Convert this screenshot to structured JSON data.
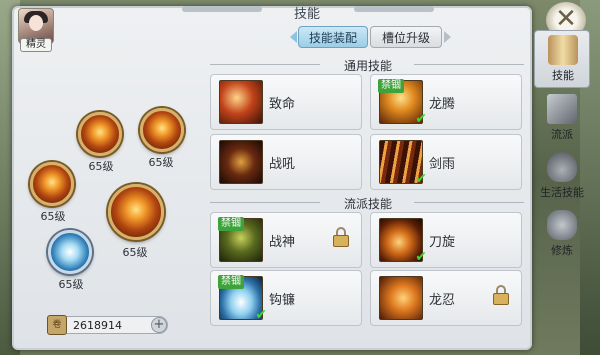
{
  "window": {
    "title": "技能",
    "close_label": "✕"
  },
  "avatar": {
    "label": "精灵"
  },
  "tabs": [
    {
      "label": "技能装配",
      "active": true
    },
    {
      "label": "槽位升级",
      "active": false
    }
  ],
  "sections": {
    "common": "通用技能",
    "school": "流派技能"
  },
  "common_skills": [
    {
      "name": "致命",
      "badge": "",
      "equipped": false,
      "locked": false
    },
    {
      "name": "龙腾",
      "badge": "禁锢",
      "equipped": true,
      "locked": false
    },
    {
      "name": "战吼",
      "badge": "",
      "equipped": false,
      "locked": false
    },
    {
      "name": "剑雨",
      "badge": "",
      "equipped": true,
      "locked": false
    }
  ],
  "school_skills": [
    {
      "name": "战神",
      "badge": "禁锢",
      "equipped": false,
      "locked": true
    },
    {
      "name": "刀旋",
      "badge": "",
      "equipped": true,
      "locked": false
    },
    {
      "name": "钩镰",
      "badge": "禁锢",
      "equipped": true,
      "locked": false
    },
    {
      "name": "龙忍",
      "badge": "",
      "equipped": false,
      "locked": true
    }
  ],
  "slots": [
    {
      "level": "65级",
      "type": "fire"
    },
    {
      "level": "65级",
      "type": "fire"
    },
    {
      "level": "65级",
      "type": "fire"
    },
    {
      "level": "65级",
      "type": "fire"
    },
    {
      "level": "65级",
      "type": "ice"
    }
  ],
  "currency": {
    "value": "2618914",
    "icon_label": "卷",
    "plus": "+"
  },
  "sidebar": [
    {
      "label": "技能",
      "icon": "scroll-icon",
      "active": true
    },
    {
      "label": "流派",
      "icon": "book-icon",
      "active": false
    },
    {
      "label": "生活技能",
      "icon": "cooking-pot-icon",
      "active": false
    },
    {
      "label": "修炼",
      "icon": "fist-icon",
      "active": false
    }
  ],
  "colors": {
    "badge": "#3ea33a",
    "check": "#3bd62e",
    "tab_active": "#9bcde6"
  }
}
